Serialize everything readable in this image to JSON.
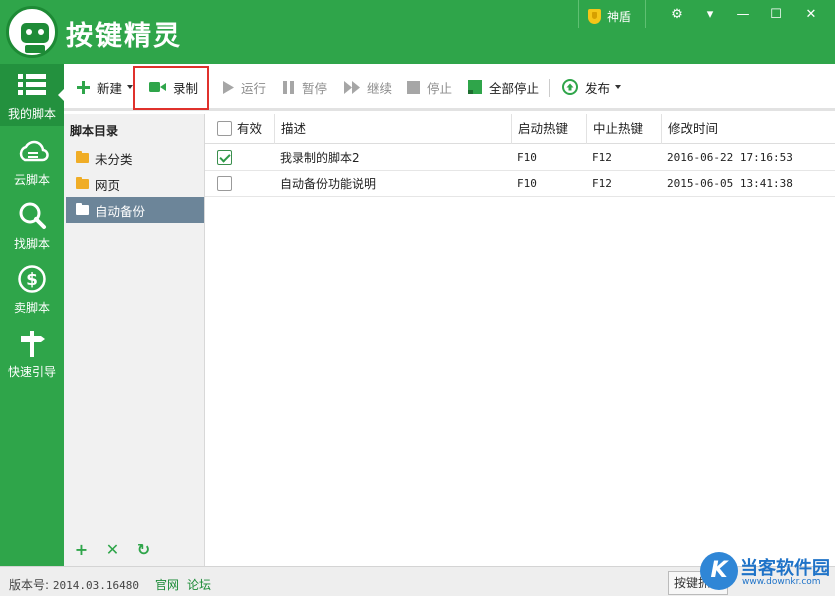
{
  "app": {
    "title": "按键精灵",
    "shield_label": "神盾"
  },
  "window_controls": {
    "settings": "⚙",
    "menu": "▾",
    "minimize": "—",
    "maximize": "☐",
    "close": "✕"
  },
  "sidebar": {
    "items": [
      {
        "label": "我的脚本",
        "icon": "list-icon",
        "active": true
      },
      {
        "label": "云脚本",
        "icon": "cloud-icon"
      },
      {
        "label": "找脚本",
        "icon": "search-icon"
      },
      {
        "label": "卖脚本",
        "icon": "dollar-icon"
      },
      {
        "label": "快速引导",
        "icon": "signpost-icon"
      }
    ]
  },
  "toolbar": {
    "new": "新建",
    "record": "录制",
    "run": "运行",
    "pause": "暂停",
    "resume": "继续",
    "stop": "停止",
    "stop_all": "全部停止",
    "publish": "发布"
  },
  "directory": {
    "heading": "脚本目录",
    "items": [
      {
        "label": "未分类"
      },
      {
        "label": "网页"
      },
      {
        "label": "自动备份",
        "selected": true
      }
    ],
    "actions": {
      "add": "+",
      "delete": "✕",
      "refresh": "↻"
    }
  },
  "table": {
    "columns": {
      "enabled": "有效",
      "desc": "描述",
      "start_hotkey": "启动热键",
      "stop_hotkey": "中止热键",
      "modified": "修改时间"
    },
    "rows": [
      {
        "enabled": true,
        "desc": "我录制的脚本2",
        "start_hotkey": "F10",
        "stop_hotkey": "F12",
        "modified": "2016-06-22 17:16:53"
      },
      {
        "enabled": false,
        "desc": "自动备份功能说明",
        "start_hotkey": "F10",
        "stop_hotkey": "F12",
        "modified": "2015-06-05 13:41:38"
      }
    ]
  },
  "status": {
    "version_label": "版本号:",
    "version_value": "2014.03.16480",
    "official_site": "官网",
    "forum": "论坛",
    "hotkey_button": "按键抓抓"
  },
  "watermark": {
    "brand": "当客软件园",
    "sub": "www.downkr.com",
    "logo_letter": "K"
  },
  "colors": {
    "primary_green": "#2fa54a",
    "record_highlight": "#e0312c",
    "selected_folder": "#6c8599"
  }
}
